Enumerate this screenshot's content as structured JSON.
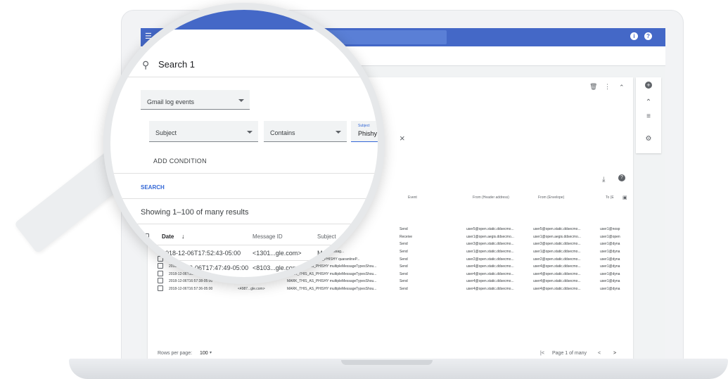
{
  "colors": {
    "topbar": "#4468c7",
    "accent": "#3367d6"
  },
  "topbar": {
    "help_label": "?",
    "info_label": "i"
  },
  "search": {
    "title": "Search 1",
    "data_source": "Gmail log events",
    "condition": {
      "attribute": "Subject",
      "operator": "Contains",
      "value_label": "Subject",
      "value": "Phishy"
    },
    "add_condition": "ADD CONDITION",
    "search_button": "SEARCH"
  },
  "results": {
    "summary": "Showing 1–100 of many results",
    "columns": [
      "Date",
      "Message ID",
      "Subject",
      "Event",
      "From (Header address)",
      "From (Envelope)",
      "To (E"
    ],
    "zoomed_rows": [
      {
        "date": "2018-12-06T17:52:43-05:00",
        "message_id": "<1301...gle.com>",
        "subject": "MA"
      },
      {
        "date": "2018-12-06T17:47:49-05:00",
        "message_id": "<8103...gle.com>",
        "subject": ""
      }
    ],
    "rows": [
      {
        "date": "",
        "message_id": "",
        "subject": "shyMessage_spam...",
        "event": "Send",
        "from_header": "user5@open.static.ddsecmo...",
        "from_envelope": "user5@open.static.ddsecmo...",
        "to": "user1@nosp"
      },
      {
        "date": "",
        "message_id": "",
        "subject": "hingMessageShouldCo...",
        "event": "Receive",
        "from_header": "user1@open.aegis.ddsecmo...",
        "from_envelope": "user1@open.aegis.ddsecmo...",
        "to": "user1@open"
      },
      {
        "date": "",
        "message_id": "",
        "subject": "quarantinePhishingMessag...",
        "event": "Send",
        "from_header": "user3@open.static.ddsecmo...",
        "from_envelope": "user3@open.static.ddsecmo...",
        "to": "user1@dyna"
      },
      {
        "date": "",
        "message_id": "",
        "subject": "HISHY quarantinePhishingMessag...",
        "event": "Send",
        "from_header": "user1@open.static.ddsecmo...",
        "from_envelope": "user1@open.static.ddsecmo...",
        "to": "user1@dyna"
      },
      {
        "date": "",
        "message_id": "",
        "subject": "ntine MARK_THIS_AS_PHISHY quarantineP...",
        "event": "Send",
        "from_header": "user2@open.static.ddsecmo...",
        "from_envelope": "user2@open.static.ddsecmo...",
        "to": "user1@dyna"
      },
      {
        "date": "2018-12-06T16:5...",
        "message_id": "",
        "subject": "MARK_THIS_AS_PHISHY multipleMessageTypesShou...",
        "event": "Send",
        "from_header": "user4@open.static.ddsecmo...",
        "from_envelope": "user4@open.static.ddsecmo...",
        "to": "user1@dyna"
      },
      {
        "date": "2018-12-06T16:57:41-05:00",
        "message_id": "<3427...gle.com>",
        "subject": "MARK_THIS_AS_PHISHY multipleMessageTypesShou...",
        "event": "Send",
        "from_header": "user4@open.static.ddsecmo...",
        "from_envelope": "user4@open.static.ddsecmo...",
        "to": "user1@dyna"
      },
      {
        "date": "2018-12-06T16:57:38-05:00",
        "message_id": "<7208...gle.com>",
        "subject": "MARK_THIS_AS_PHISHY multipleMessageTypesShou...",
        "event": "Send",
        "from_header": "user4@open.static.ddsecmo...",
        "from_envelope": "user4@open.static.ddsecmo...",
        "to": "user1@dyna"
      },
      {
        "date": "2018-12-06T16:57:36-05:00",
        "message_id": "<4987...gle.com>",
        "subject": "MARK_THIS_AS_PHISHY multipleMessageTypesShou...",
        "event": "Send",
        "from_header": "user4@open.static.ddsecmo...",
        "from_envelope": "user4@open.static.ddsecmo...",
        "to": "user1@dyna"
      }
    ]
  },
  "pagination": {
    "rows_per_page_label": "Rows per page:",
    "rows_per_page": "100",
    "page_label": "Page 1 of many"
  },
  "icons": {
    "menu": "☰",
    "search": "⚲",
    "delete": "🗑",
    "more": "⋮",
    "collapse": "⌃",
    "add": "+",
    "expand": "⌃",
    "delete_list": "≡",
    "settings": "⚙",
    "download": "⤓",
    "help": "?",
    "sort": "↓",
    "close": "×",
    "first_page": "|<",
    "prev": "<",
    "next": ">",
    "column_menu": "▣"
  }
}
